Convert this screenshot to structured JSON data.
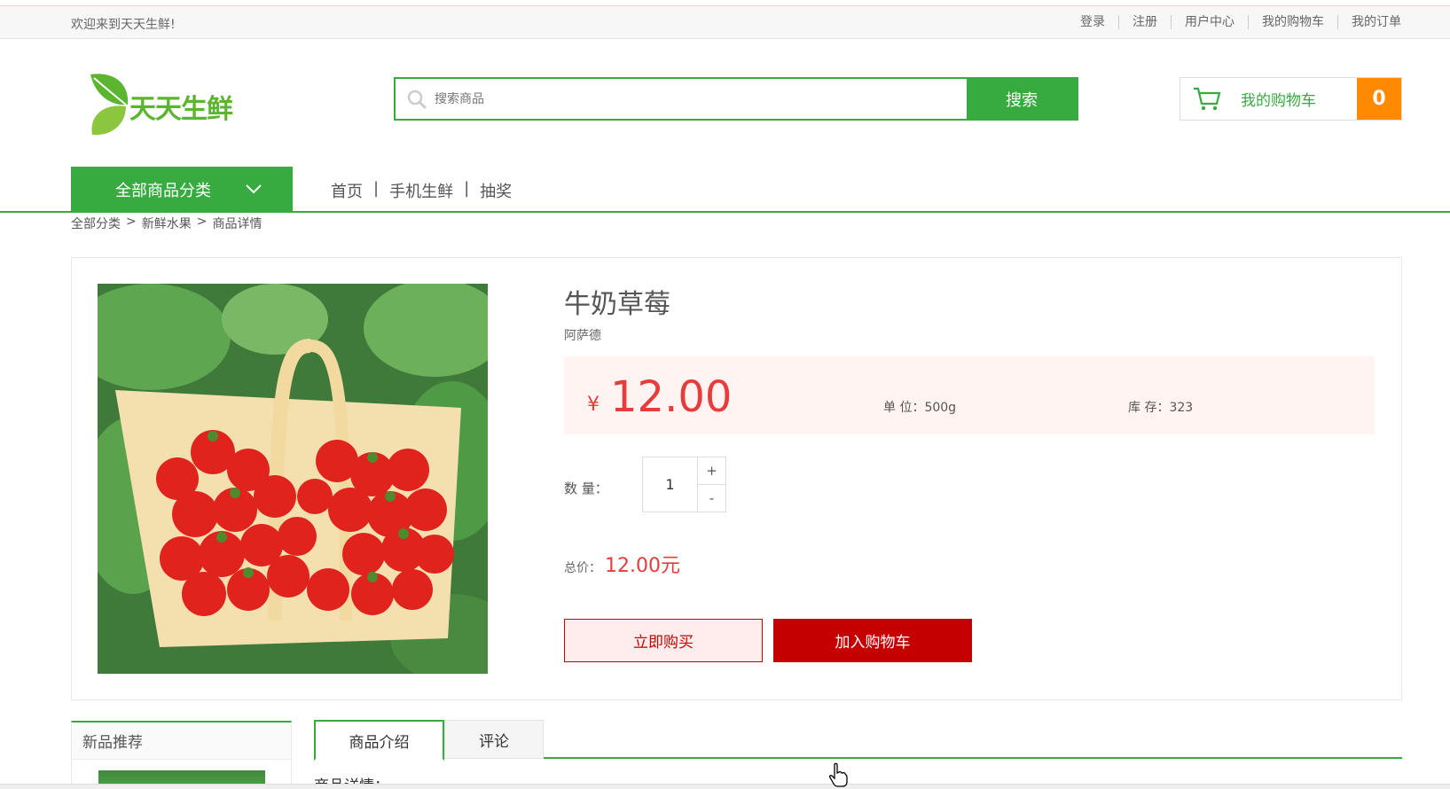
{
  "topbar": {
    "welcome": "欢迎来到天天生鲜!",
    "links": [
      "登录",
      "注册",
      "用户中心",
      "我的购物车",
      "我的订单"
    ]
  },
  "header": {
    "logo_text": "天天生鲜",
    "search_placeholder": "搜索商品",
    "search_button": "搜索",
    "cart_label": "我的购物车",
    "cart_count": "0"
  },
  "nav": {
    "all_categories": "全部商品分类",
    "links": [
      "首页",
      "手机生鲜",
      "抽奖"
    ]
  },
  "breadcrumb": [
    "全部分类",
    "新鲜水果",
    "商品详情"
  ],
  "product": {
    "name": "牛奶草莓",
    "brand": "阿萨德",
    "currency": "¥",
    "price": "12.00",
    "unit": "单 位：500g",
    "stock": "库 存：323",
    "qty_label": "数 量：",
    "qty": "1",
    "plus": "+",
    "minus": "-",
    "total_label": "总价：",
    "total": "12.00元",
    "buy_now": "立即购买",
    "add_cart": "加入购物车"
  },
  "lower": {
    "new_rec_title": "新品推荐",
    "tabs": [
      "商品介绍",
      "评论"
    ],
    "detail_label": "商品详情："
  },
  "colors": {
    "green": "#37ab40",
    "orange": "#ff8a00",
    "red": "#c40000",
    "price_red": "#e63c3c"
  }
}
